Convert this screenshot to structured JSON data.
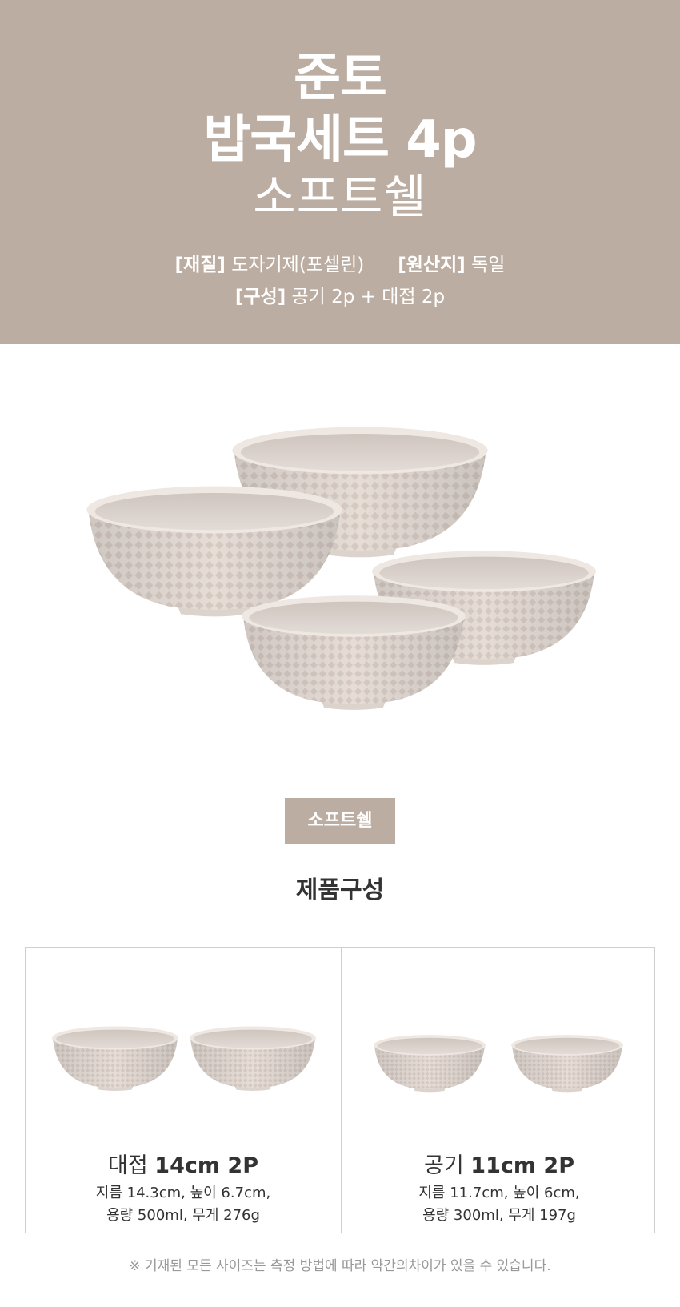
{
  "hero": {
    "brand": "준토",
    "product": "밥국세트 4p",
    "color": "소프트쉘",
    "material_label": "[재질]",
    "material_value": "도자기제(포셀린)",
    "origin_label": "[원산지]",
    "origin_value": "독일",
    "composition_label": "[구성]",
    "composition_value": "공기 2p + 대접 2p"
  },
  "color_badge": "소프트쉘",
  "section_title": "제품구성",
  "components": [
    {
      "name_prefix": "대접",
      "name_size": "14cm 2P",
      "desc_line1": "지름 14.3cm, 높이 6.7cm,",
      "desc_line2": "용량 500ml, 무게 276g"
    },
    {
      "name_prefix": "공기",
      "name_size": "11cm 2P",
      "desc_line1": "지름 11.7cm, 높이 6cm,",
      "desc_line2": "용량 300ml, 무게 197g"
    }
  ],
  "notice": "※ 기재된 모든 사이즈는 측정 방법에 따라 약간의차이가 있을 수 있습니다.",
  "colors": {
    "hero_bg": "#bcada2",
    "bowl_body": "#e9e1dc",
    "bowl_shadow": "#d4c8c1",
    "bowl_inner": "#d9d0cb"
  }
}
